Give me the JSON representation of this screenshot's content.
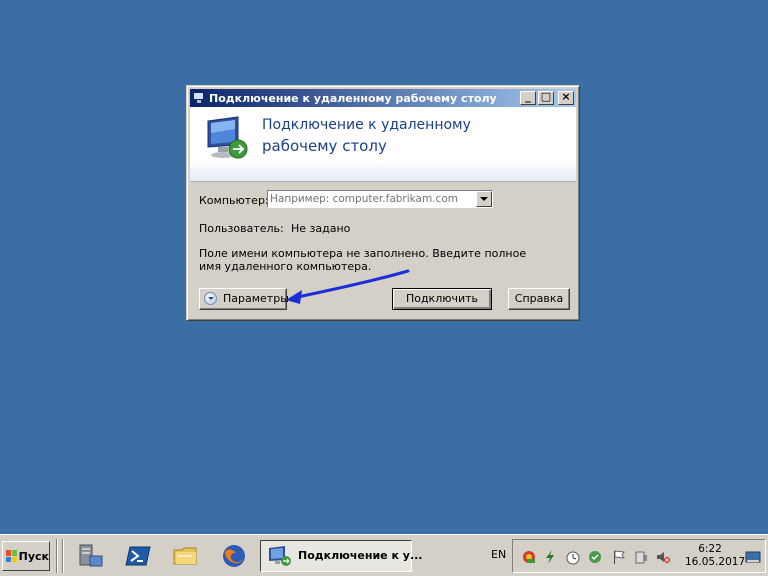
{
  "window": {
    "title": "Подключение к удаленному рабочему столу",
    "buttons": {
      "minimize": "_",
      "maximize": "□",
      "close": "×"
    },
    "banner_line1": "Подключение к удаленному",
    "banner_line2": "рабочему столу"
  },
  "form": {
    "computer_label": "Компьютер:",
    "computer_placeholder": "Например: computer.fabrikam.com",
    "computer_value": "",
    "user_label": "Пользователь:",
    "user_value": "Не задано",
    "message_line1": "Поле имени компьютера не заполнено. Введите полное",
    "message_line2": "имя удаленного компьютера."
  },
  "buttons": {
    "options": "Параметры",
    "connect": "Подключить",
    "help": "Справка"
  },
  "annotation": {
    "color": "#1a2fd6"
  },
  "taskbar": {
    "start_label": "Пуск",
    "quick_launch": [
      "server-manager-icon",
      "powershell-icon",
      "explorer-folder-icon",
      "firefox-icon"
    ],
    "active_task": "Подключение к у...",
    "language": "EN",
    "tray_icons": [
      "network-icon",
      "power-icon",
      "clock-icon",
      "security-icon",
      "flag-icon",
      "action-center-icon",
      "volume-icon"
    ],
    "time": "6:22",
    "date": "16.05.2017"
  },
  "colors": {
    "desktop": "#3a6ea5",
    "titlebar_start": "#0a246a",
    "titlebar_end": "#a6caf0",
    "banner_text": "#1a3e8c"
  }
}
